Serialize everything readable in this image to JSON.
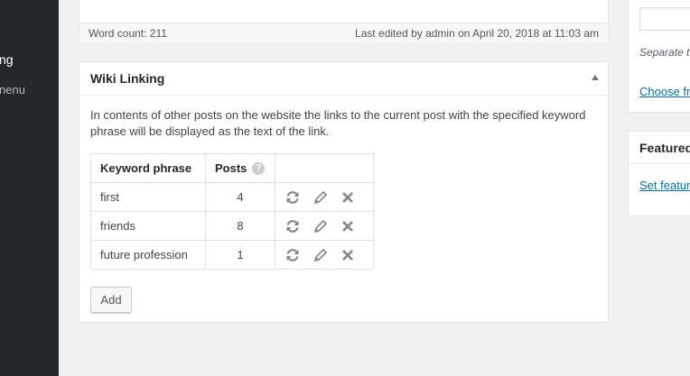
{
  "sidebar": {
    "items": [
      {
        "label": "ng"
      },
      {
        "label": "nenu"
      }
    ]
  },
  "editor": {
    "word_count": "Word count: 211",
    "last_edited": "Last edited by admin on April 20, 2018 at 11:03 am"
  },
  "wiki": {
    "title": "Wiki Linking",
    "description": "In contents of other posts on the website the links to the current post with the specified keyword phrase will be displayed as the text of the link.",
    "columns": {
      "keyword": "Keyword phrase",
      "posts": "Posts",
      "help": "?"
    },
    "rows": [
      {
        "keyword": "first",
        "posts": "4"
      },
      {
        "keyword": "friends",
        "posts": "8"
      },
      {
        "keyword": "future profession",
        "posts": "1"
      }
    ],
    "add_label": "Add"
  },
  "tags": {
    "hint": "Separate t",
    "choose_link": "Choose fr"
  },
  "featured": {
    "title": "Featured",
    "set_link": "Set featur"
  },
  "icons": [
    "refresh-icon",
    "edit-pencil-icon",
    "delete-x-icon",
    "help-icon",
    "collapse-arrow-icon"
  ]
}
